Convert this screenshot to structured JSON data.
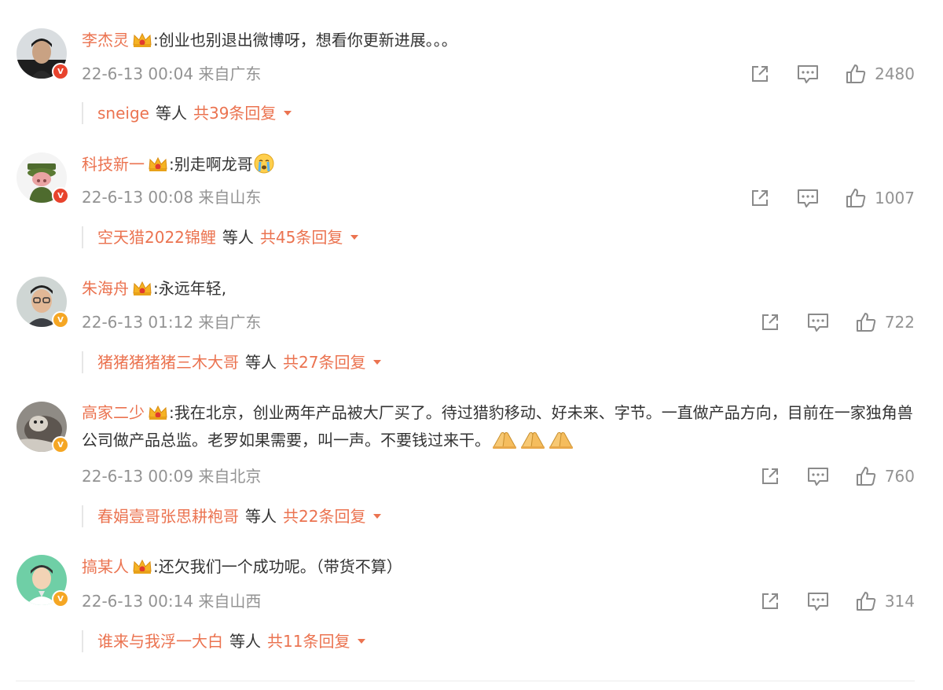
{
  "comments": [
    {
      "username": "李杰灵",
      "text": ":创业也别退出微博呀，想看你更新进展。。。",
      "time": "22-6-13 00:04 来自广东",
      "likes": "2480",
      "verified_color": "red",
      "reply_user": "sneige",
      "reply_mid": "等人",
      "reply_total": "共39条回复"
    },
    {
      "username": "科技新一",
      "text": ":别走啊龙哥",
      "time": "22-6-13 00:08 来自山东",
      "likes": "1007",
      "verified_color": "red",
      "reply_user": "空天猎2022锦鲤",
      "reply_mid": "等人",
      "reply_total": "共45条回复"
    },
    {
      "username": "朱海舟",
      "text": ":永远年轻,",
      "time": "22-6-13 01:12 来自广东",
      "likes": "722",
      "verified_color": "gold",
      "reply_user": "猪猪猪猪猪三木大哥",
      "reply_mid": "等人",
      "reply_total": "共27条回复"
    },
    {
      "username": "高家二少",
      "text": ":我在北京，创业两年产品被大厂买了。待过猎豹移动、好未来、字节。一直做产品方向，目前在一家独角兽公司做产品总监。老罗如果需要，叫一声。不要钱过来干。",
      "time": "22-6-13 00:09 来自北京",
      "likes": "760",
      "verified_color": "gold",
      "reply_user": "春娟壹哥张思耕袍哥",
      "reply_mid": "等人",
      "reply_total": "共22条回复"
    },
    {
      "username": "搞某人",
      "text": ":还欠我们一个成功呢。（带货不算）",
      "time": "22-6-13 00:14 来自山西",
      "likes": "314",
      "verified_color": "gold",
      "reply_user": "谁来与我浮一大白",
      "reply_mid": "等人",
      "reply_total": "共11条回复"
    }
  ],
  "icons": {
    "share": "share-icon",
    "comment": "comment-icon",
    "like": "like-icon",
    "crown": "crown-badge-icon",
    "verified": "verified-v-icon",
    "expand": "caret-down-icon",
    "cry_emoji": "crying-emoji-icon",
    "pray_emoji": "praying-hands-emoji-icon"
  },
  "colors": {
    "username": "#eb7350",
    "text": "#333333",
    "meta": "#939393",
    "verified_red": "#e8432d",
    "verified_gold": "#f5a623"
  }
}
